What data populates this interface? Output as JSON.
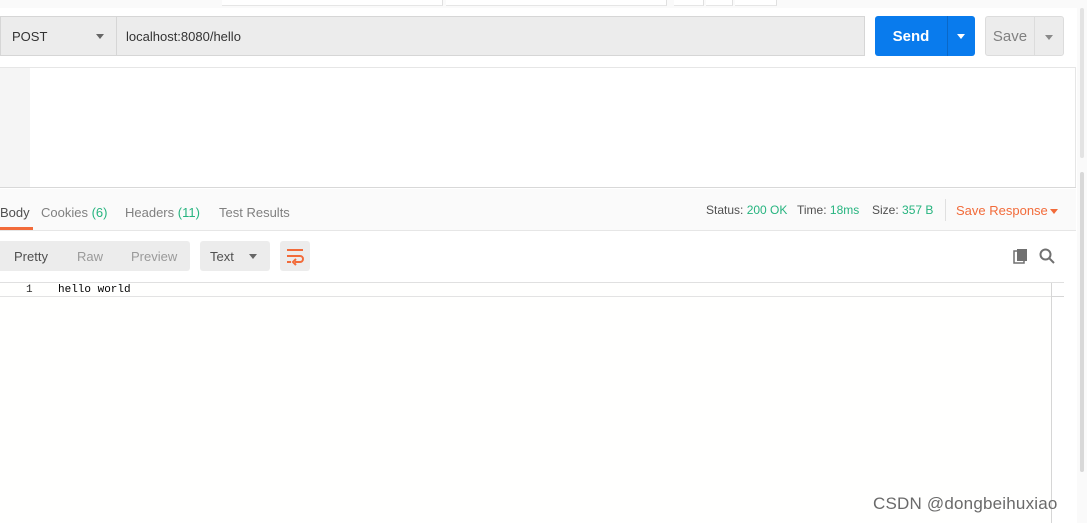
{
  "request": {
    "method": "POST",
    "url": "localhost:8080/hello",
    "send_label": "Send",
    "save_label": "Save"
  },
  "response_tabs": [
    {
      "label": "Body",
      "count": ""
    },
    {
      "label": "Cookies",
      "count": "(6)"
    },
    {
      "label": "Headers",
      "count": "(11)"
    },
    {
      "label": "Test Results",
      "count": ""
    }
  ],
  "status": {
    "status_label": "Status:",
    "status_value": "200 OK",
    "time_label": "Time:",
    "time_value": "18ms",
    "size_label": "Size:",
    "size_value": "357 B",
    "save_response_label": "Save Response"
  },
  "view": {
    "pretty_label": "Pretty",
    "raw_label": "Raw",
    "preview_label": "Preview",
    "format_label": "Text"
  },
  "response_body": {
    "lines": [
      {
        "number": "1",
        "text": "hello world"
      }
    ]
  },
  "watermark": "CSDN @dongbeihuxiao",
  "colors": {
    "send_blue": "#097bed",
    "accent_orange": "#f26b3a",
    "success_green": "#26b47f"
  }
}
